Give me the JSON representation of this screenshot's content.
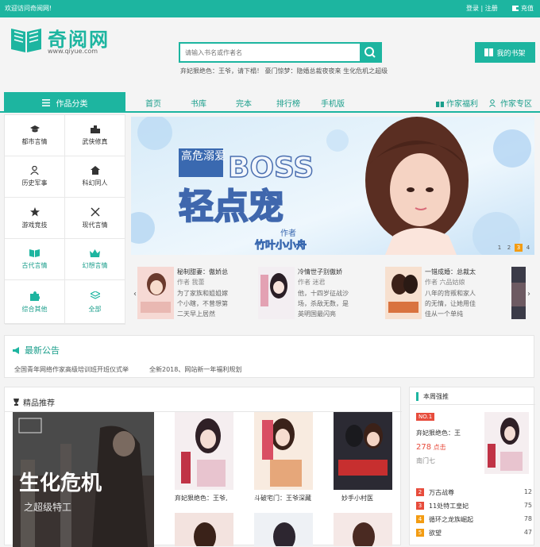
{
  "topbar": {
    "welcome": "欢迎访问奇阅网!",
    "login": "登录 | 注册",
    "recharge": "充值"
  },
  "logo": {
    "name": "奇阅网",
    "url": "www.qiyue.com"
  },
  "search": {
    "placeholder": "请输入书名或作者名",
    "hot": "弃妃狠绝色：王爷，请下榻！  豪门惊梦：隐婚总裁夜夜来  生化危机之超级"
  },
  "shelf": {
    "label": "我的书架"
  },
  "nav": {
    "category": "作品分类",
    "items": [
      "首页",
      "书库",
      "完本",
      "排行榜",
      "手机版"
    ],
    "welfare": "作家福利",
    "zone": "作家专区"
  },
  "categories": [
    {
      "label": "都市言情",
      "icon": "graduation-cap-icon"
    },
    {
      "label": "武侠修真",
      "icon": "city-icon"
    },
    {
      "label": "历史军事",
      "icon": "person-icon"
    },
    {
      "label": "科幻同人",
      "icon": "home-icon"
    },
    {
      "label": "游戏竞技",
      "icon": "star-icon"
    },
    {
      "label": "现代言情",
      "icon": "swords-icon"
    },
    {
      "label": "古代言情",
      "icon": "book-open-icon"
    },
    {
      "label": "幻想言情",
      "icon": "crown-icon"
    },
    {
      "label": "综合其他",
      "icon": "puzzle-icon"
    },
    {
      "label": "全部",
      "icon": "layers-icon"
    }
  ],
  "banner": {
    "line1": "高危溺爱",
    "line2": "BOSS",
    "line3": "轻点宠",
    "author_tag": "作者",
    "author": "竹叶小小舟",
    "pages": [
      "1",
      "2",
      "3",
      "4"
    ],
    "active_page": "3"
  },
  "slider_books": [
    {
      "title": "秘制甜妻：傲娇总",
      "author": "作者  我蕾",
      "desc": "为了家族和姐姐嫁个小瞎，不曾想第二天早上居然"
    },
    {
      "title": "冷情世子别傲娇",
      "author": "作者  迷君",
      "desc": "他，十四岁征战沙场，杀敌无数，是英明国最闪亮"
    },
    {
      "title": "一错成婚：总裁太",
      "author": "作者  六品姑娘",
      "desc": "八年的背叛和家人的无情，让她用佳佳从一个单纯"
    }
  ],
  "notice": {
    "title": "最新公告",
    "items": [
      "全国青年网络作家高级培训班开班仪式举",
      "全新2018、网站新一年福利规划"
    ]
  },
  "recommend": {
    "title": "精品推荐",
    "big_cover_title": "生化危机",
    "big_cover_sub": "之超级特工",
    "books": [
      "弃妃狠绝色：王爷,",
      "斗破宅门：王爷深藏",
      "妙手小村医"
    ]
  },
  "weekly": {
    "title": "本周强推",
    "badge": "NO.1",
    "top_title": "弃妃狠绝色：王",
    "top_count": "278",
    "top_count_unit": "点击",
    "top_author": "南门七",
    "ranks": [
      {
        "num": "2",
        "title": "万古战尊",
        "value": "12",
        "color": "#e74c3c"
      },
      {
        "num": "3",
        "title": "11处特工皇妃",
        "value": "75",
        "color": "#e74c3c"
      },
      {
        "num": "4",
        "title": "循环之龙族崛起",
        "value": "78",
        "color": "#f39c12"
      },
      {
        "num": "5",
        "title": "欲望",
        "value": "47",
        "color": "#f39c12"
      }
    ]
  },
  "colors": {
    "accent": "#1db5a0",
    "highlight": "#f39c12",
    "red": "#e74c3c"
  }
}
